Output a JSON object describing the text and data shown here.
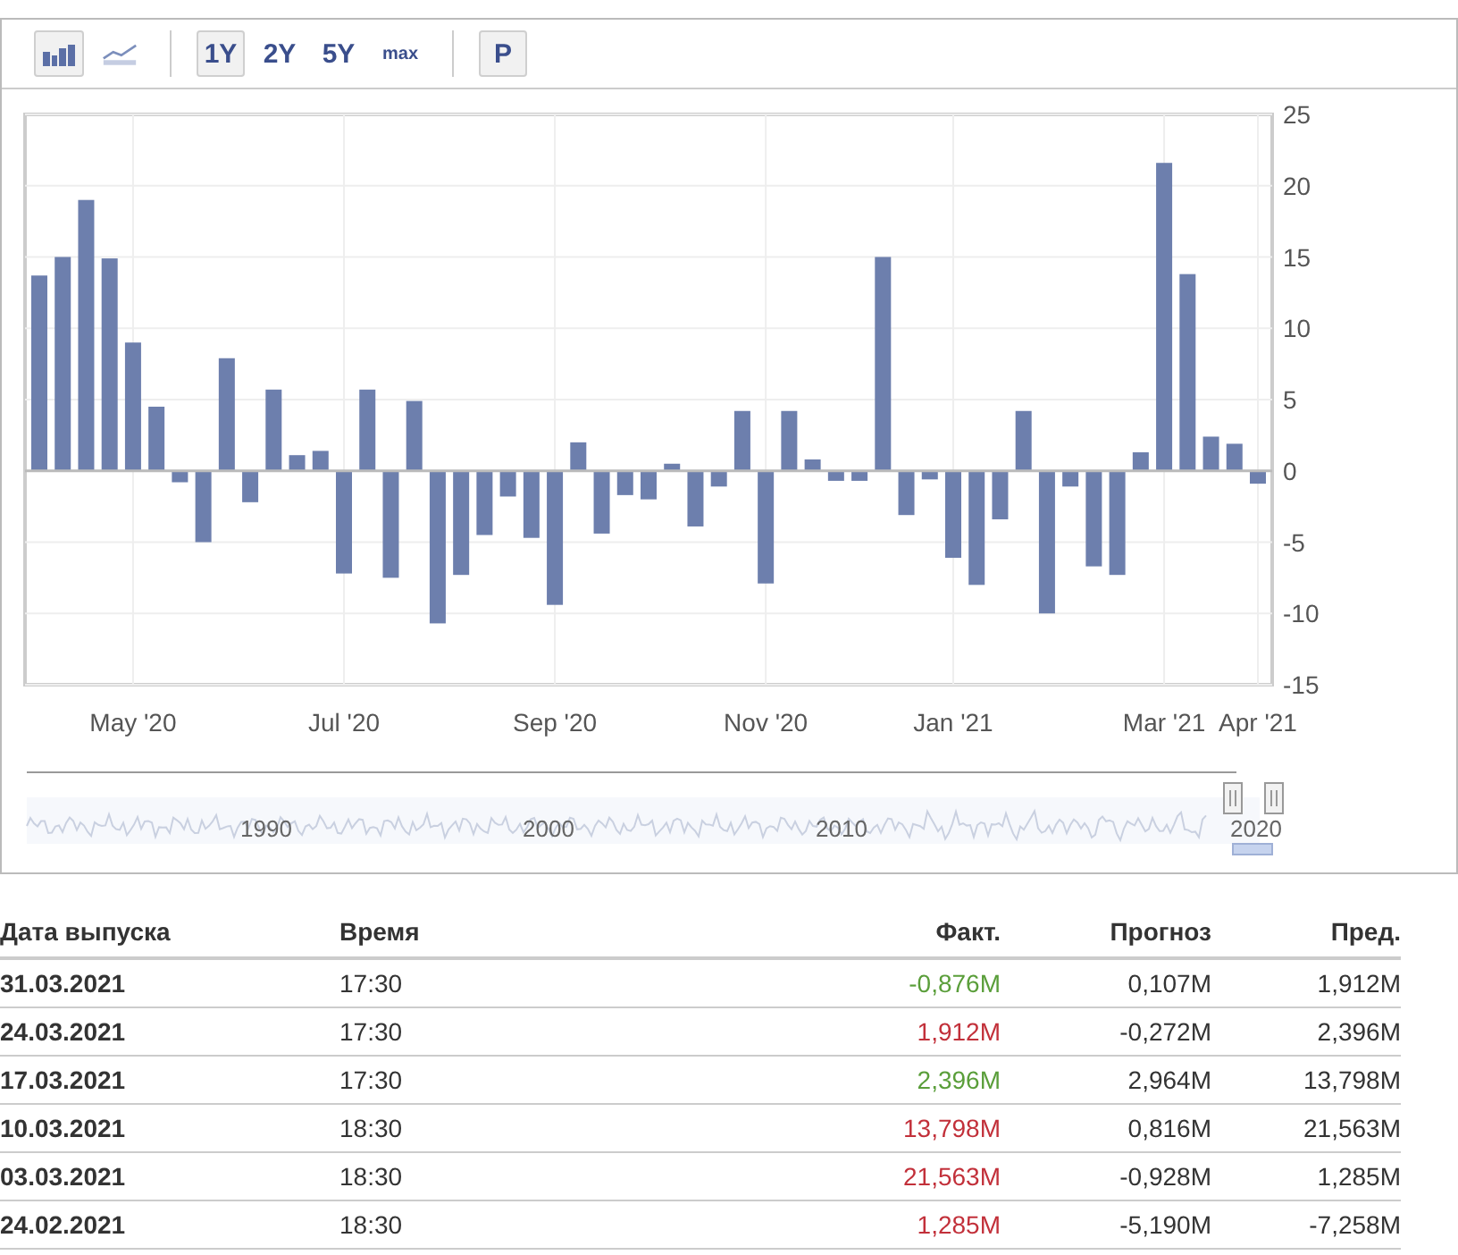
{
  "toolbar": {
    "chart_types": [
      {
        "kind": "bar",
        "selected": true
      },
      {
        "kind": "line",
        "selected": false
      }
    ],
    "ranges": [
      {
        "label": "1Y",
        "selected": true
      },
      {
        "label": "2Y",
        "selected": false
      },
      {
        "label": "5Y",
        "selected": false
      },
      {
        "label": "max",
        "selected": false
      }
    ],
    "extra": [
      {
        "label": "P",
        "selected": true
      }
    ]
  },
  "chart": {
    "chart_data": {
      "type": "bar",
      "ylim": [
        -15,
        25
      ],
      "yticks": [
        25,
        20,
        15,
        10,
        5,
        0,
        -5,
        -10,
        -15
      ],
      "grid": true,
      "categories": [
        null,
        null,
        null,
        null,
        "May '20",
        null,
        null,
        null,
        null,
        null,
        null,
        null,
        null,
        "Jul '20",
        null,
        null,
        null,
        null,
        null,
        null,
        null,
        null,
        "Sep '20",
        null,
        null,
        null,
        null,
        null,
        null,
        null,
        null,
        "Nov '20",
        null,
        null,
        null,
        null,
        null,
        null,
        null,
        "Jan '21",
        null,
        null,
        null,
        null,
        null,
        null,
        null,
        null,
        "Mar '21",
        null,
        null,
        null,
        "Apr '21"
      ],
      "series": [
        {
          "color": "#6d7fad",
          "values": [
            13.7,
            15.0,
            19.0,
            14.9,
            9.0,
            4.5,
            -0.8,
            -5.0,
            7.9,
            -2.2,
            5.7,
            1.1,
            1.4,
            -7.2,
            5.7,
            -7.5,
            4.9,
            -10.7,
            -7.3,
            -4.5,
            -1.8,
            -4.7,
            -9.4,
            2.0,
            -4.4,
            -1.7,
            -2.0,
            0.5,
            -3.9,
            -1.1,
            4.2,
            -7.9,
            4.2,
            0.8,
            -0.7,
            -0.7,
            15.0,
            -3.1,
            -0.6,
            -6.1,
            -8.0,
            -3.4,
            4.2,
            -10.0,
            -1.1,
            -6.7,
            -7.3,
            1.3,
            21.6,
            13.8,
            2.4,
            1.9,
            -0.9
          ]
        }
      ]
    }
  },
  "navigator": {
    "year_labels": [
      "1990",
      "2000",
      "2010",
      "2020"
    ]
  },
  "table": {
    "columns": [
      "Дата выпуска",
      "Время",
      "Факт.",
      "Прогноз",
      "Пред."
    ],
    "rows": [
      {
        "date": "31.03.2021",
        "time": "17:30",
        "actual": "-0,876M",
        "color": "#5a9e3a",
        "forecast": "0,107M",
        "previous": "1,912M"
      },
      {
        "date": "24.03.2021",
        "time": "17:30",
        "actual": "1,912M",
        "color": "#c2303a",
        "forecast": "-0,272M",
        "previous": "2,396M"
      },
      {
        "date": "17.03.2021",
        "time": "17:30",
        "actual": "2,396M",
        "color": "#5a9e3a",
        "forecast": "2,964M",
        "previous": "13,798M"
      },
      {
        "date": "10.03.2021",
        "time": "18:30",
        "actual": "13,798M",
        "color": "#c2303a",
        "forecast": "0,816M",
        "previous": "21,563M"
      },
      {
        "date": "03.03.2021",
        "time": "18:30",
        "actual": "21,563M",
        "color": "#c2303a",
        "forecast": "-0,928M",
        "previous": "1,285M"
      },
      {
        "date": "24.02.2021",
        "time": "18:30",
        "actual": "1,285M",
        "color": "#c2303a",
        "forecast": "-5,190M",
        "previous": "-7,258M"
      }
    ]
  }
}
